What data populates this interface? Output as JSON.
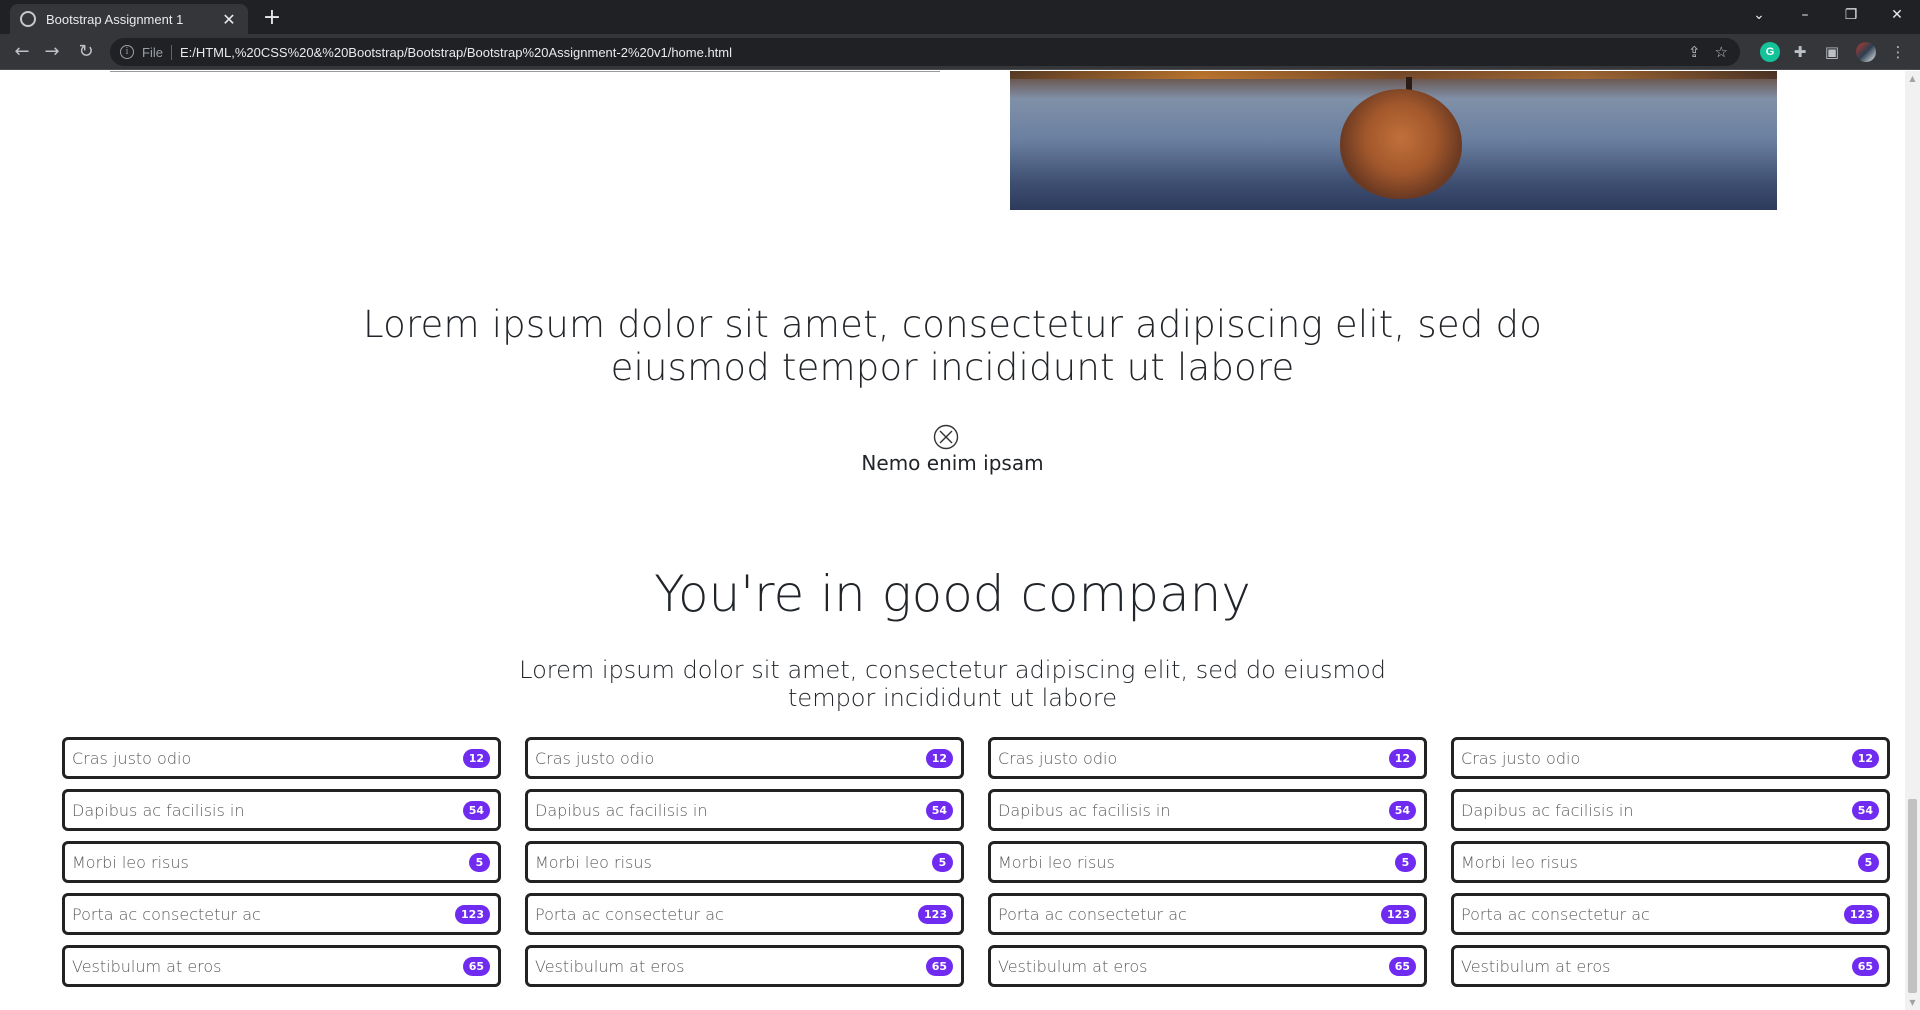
{
  "browser": {
    "tab_title": "Bootstrap Assignment 1",
    "file_label": "File",
    "url": "E:/HTML,%20CSS%20&%20Bootstrap/Bootstrap/Bootstrap%20Assignment-2%20v1/home.html",
    "grammarly_label": "G"
  },
  "lead": {
    "heading": "Lorem ipsum dolor sit amet, consectetur adipiscing elit, sed do eiusmod tempor incididunt ut labore",
    "author": "Nemo enim ipsam"
  },
  "company": {
    "title": "You're in good company",
    "subtitle": "Lorem ipsum dolor sit amet, consectetur adipiscing elit, sed do eiusmod tempor incididunt ut labore"
  },
  "lists": [
    {
      "items": [
        {
          "label": "Cras justo odio",
          "badge": "12"
        },
        {
          "label": "Dapibus ac facilisis in",
          "badge": "54"
        },
        {
          "label": "Morbi leo risus",
          "badge": "5"
        },
        {
          "label": "Porta ac consectetur ac",
          "badge": "123"
        },
        {
          "label": "Vestibulum at eros",
          "badge": "65"
        }
      ]
    },
    {
      "items": [
        {
          "label": "Cras justo odio",
          "badge": "12"
        },
        {
          "label": "Dapibus ac facilisis in",
          "badge": "54"
        },
        {
          "label": "Morbi leo risus",
          "badge": "5"
        },
        {
          "label": "Porta ac consectetur ac",
          "badge": "123"
        },
        {
          "label": "Vestibulum at eros",
          "badge": "65"
        }
      ]
    },
    {
      "items": [
        {
          "label": "Cras justo odio",
          "badge": "12"
        },
        {
          "label": "Dapibus ac facilisis in",
          "badge": "54"
        },
        {
          "label": "Morbi leo risus",
          "badge": "5"
        },
        {
          "label": "Porta ac consectetur ac",
          "badge": "123"
        },
        {
          "label": "Vestibulum at eros",
          "badge": "65"
        }
      ]
    },
    {
      "items": [
        {
          "label": "Cras justo odio",
          "badge": "12"
        },
        {
          "label": "Dapibus ac facilisis in",
          "badge": "54"
        },
        {
          "label": "Morbi leo risus",
          "badge": "5"
        },
        {
          "label": "Porta ac consectetur ac",
          "badge": "123"
        },
        {
          "label": "Vestibulum at eros",
          "badge": "65"
        }
      ]
    }
  ],
  "colors": {
    "badge": "#6f2bf0",
    "item_border": "#222222"
  }
}
